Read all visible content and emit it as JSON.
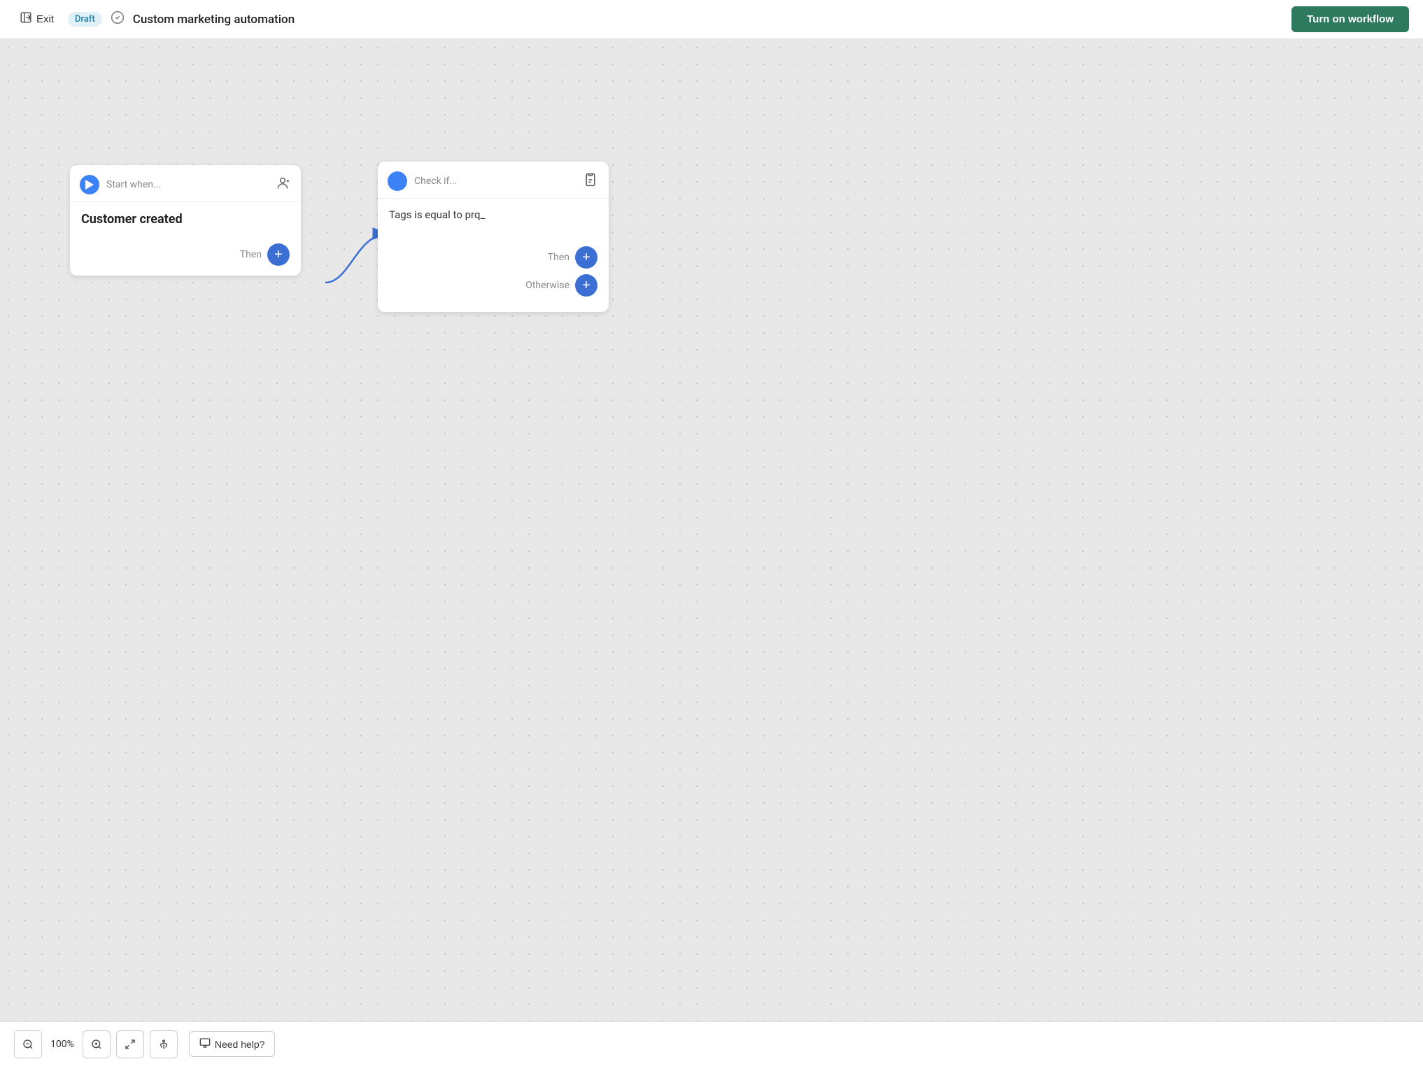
{
  "header": {
    "exit_label": "Exit",
    "draft_label": "Draft",
    "workflow_title": "Custom marketing automation",
    "turn_on_label": "Turn on workflow"
  },
  "start_node": {
    "header_label": "Start when...",
    "main_text": "Customer created",
    "footer_label": "Then"
  },
  "check_node": {
    "header_label": "Check if...",
    "condition_text": "Tags is equal to prq_",
    "then_label": "Then",
    "otherwise_label": "Otherwise"
  },
  "toolbar": {
    "zoom_pct": "100%",
    "help_label": "Need help?"
  },
  "colors": {
    "accent_blue": "#3b82f6",
    "btn_blue": "#3b6fd4",
    "green_dark": "#2d7a5f"
  }
}
